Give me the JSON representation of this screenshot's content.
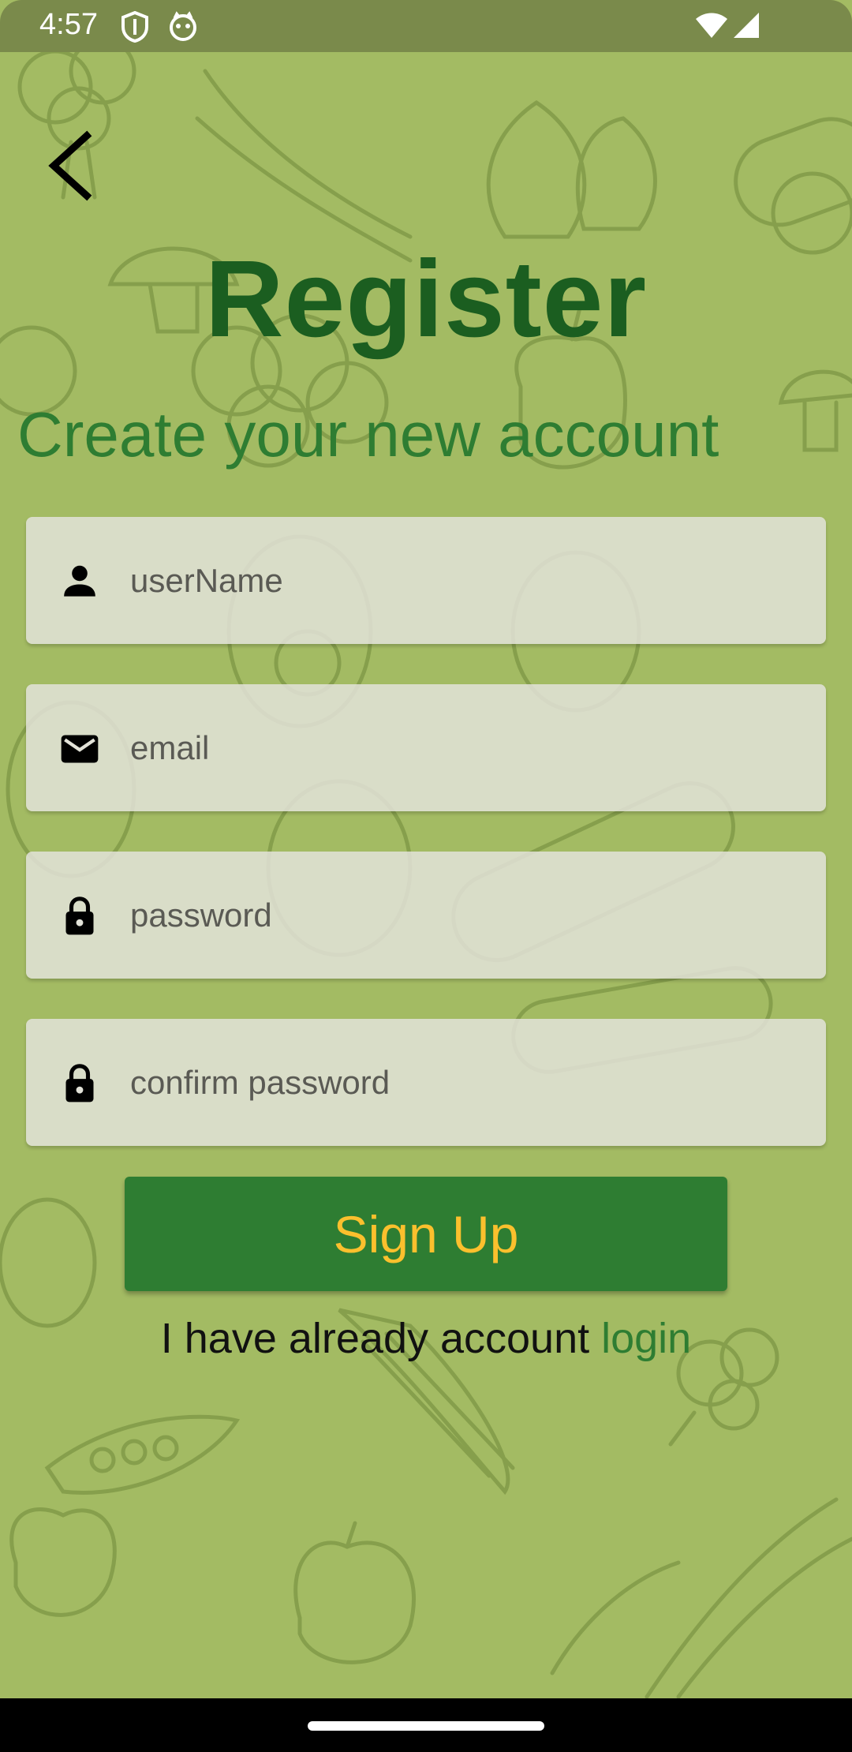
{
  "status_bar": {
    "time": "4:57",
    "icons": [
      "shield-icon",
      "cat-icon",
      "wifi-icon",
      "signal-icon"
    ]
  },
  "header": {
    "back_icon": "chevron-left-icon",
    "title": "Register",
    "subtitle": "Create your new account"
  },
  "form": {
    "fields": [
      {
        "icon": "person-icon",
        "placeholder": "userName",
        "value": ""
      },
      {
        "icon": "mail-icon",
        "placeholder": "email",
        "value": ""
      },
      {
        "icon": "lock-icon",
        "placeholder": "password",
        "value": ""
      },
      {
        "icon": "lock-icon",
        "placeholder": "confirm password",
        "value": ""
      }
    ],
    "submit_label": "Sign Up"
  },
  "footer": {
    "prompt": "I have already account ",
    "login_label": "login"
  },
  "colors": {
    "background": "#a3bb63",
    "title": "#1b5e20",
    "accent": "#2e7d32",
    "button_text": "#fbc02d",
    "field_bg": "#e2e2d8"
  }
}
